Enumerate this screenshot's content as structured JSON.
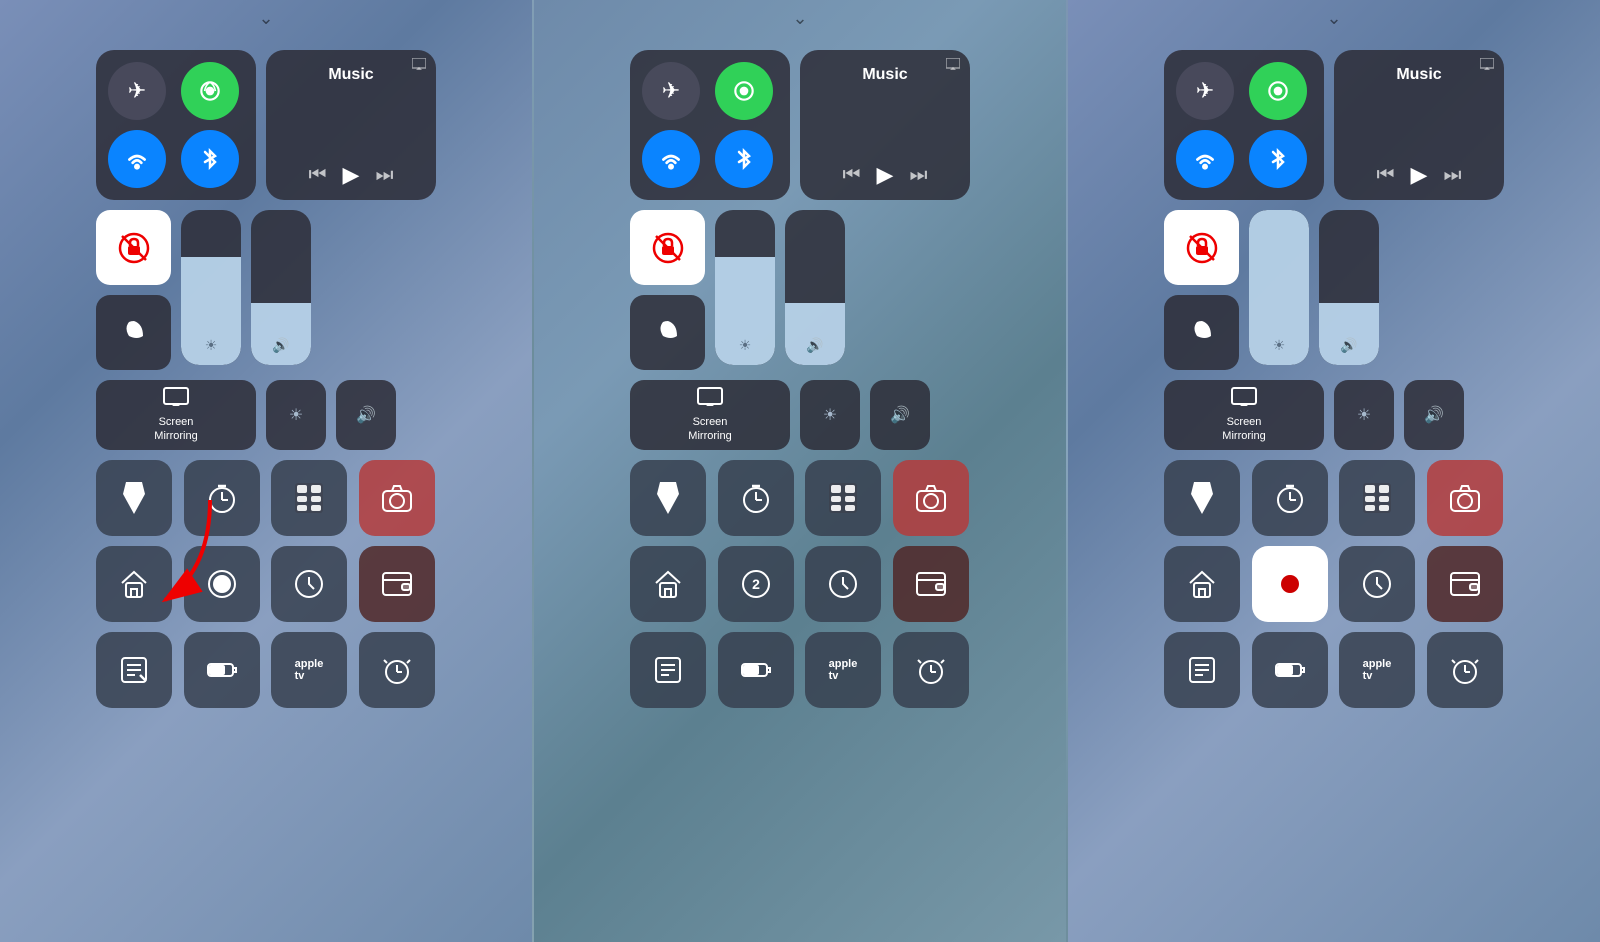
{
  "panels": [
    {
      "id": "panel-1",
      "notch": "⌄",
      "top": {
        "connectivity": {
          "airplane": "✈",
          "cellular_active": true,
          "wifi_active": true,
          "bluetooth_active": true
        },
        "music": {
          "title": "Music",
          "prev": "«",
          "play": "▶",
          "next": "»"
        }
      },
      "mid": {
        "lock_icon": "🔒",
        "moon_icon": "☽",
        "brightness_fill_pct": 70,
        "volume_fill_pct": 40
      },
      "screen_mirroring": {
        "icon": "⬜",
        "label": "Screen\nMirroring"
      },
      "row3": [
        "🔦",
        "⏱",
        "🧮",
        "📷"
      ],
      "row4": [
        "🏠",
        "⏺",
        "⏰",
        "💳"
      ],
      "row5": [
        "✏️",
        "🔋",
        "📺",
        "⏰"
      ],
      "has_arrow": true
    },
    {
      "id": "panel-2",
      "notch": "⌄",
      "row4_special": "2"
    },
    {
      "id": "panel-3",
      "notch": "⌄",
      "row4_special": "record_active"
    }
  ],
  "labels": {
    "screen_mirroring": "Screen\nMirroring",
    "music": "Music"
  },
  "colors": {
    "green": "#30d158",
    "blue": "#0a84ff",
    "dark_tile": "rgba(45,45,55,0.85)",
    "app_tile": "rgba(55,65,80,0.85)",
    "red_tile": "rgba(180,60,60,0.85)",
    "white": "#ffffff",
    "red": "#cc0000"
  }
}
